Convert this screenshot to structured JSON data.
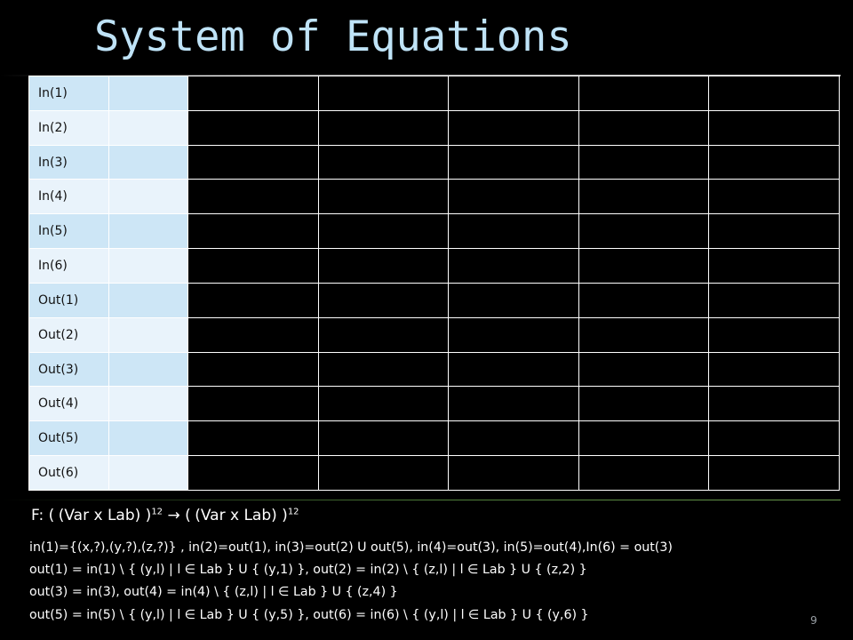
{
  "slide": {
    "title": "System of Equations",
    "page_number": "9"
  },
  "table": {
    "empty_marker": "  ",
    "rows": [
      {
        "label": "In(1)"
      },
      {
        "label": "In(2)"
      },
      {
        "label": "In(3)"
      },
      {
        "label": "In(4)"
      },
      {
        "label": "In(5)"
      },
      {
        "label": "In(6)"
      },
      {
        "label": "Out(1)"
      },
      {
        "label": "Out(2)"
      },
      {
        "label": "Out(3)"
      },
      {
        "label": "Out(4)"
      },
      {
        "label": "Out(5)"
      },
      {
        "label": "Out(6)"
      }
    ]
  },
  "function_signature": {
    "prefix": "F: (",
    "box1": "  ",
    "mid1": "(Var x Lab) )",
    "exp1": "12",
    "arrow": " → (",
    "box2": "  ",
    "mid2": "(Var x Lab) )",
    "exp2": "12"
  },
  "equations": [
    "in(1)={(x,?),(y,?),(z,?)} , in(2)=out(1), in(3)=out(2) U out(5), in(4)=out(3), in(5)=out(4),In(6) = out(3)",
    "out(1) = in(1) \\ { (y,l) | l ∈ Lab } U { (y,1) }, out(2) = in(2) \\ { (z,l) | l ∈ Lab } U { (z,2) }",
    "out(3) = in(3), out(4) = in(4) \\ { (z,l) | l ∈ Lab } U { (z,4) }",
    "out(5) = in(5) \\ { (y,l) | l ∈ Lab } U { (y,5) }, out(6) = in(6) \\ { (y,l) | l ∈ Lab } U { (y,6) }"
  ],
  "colors": {
    "background": "#000000",
    "title": "#bfe3f7",
    "row_odd": "#cde6f6",
    "row_even": "#e9f3fb"
  }
}
